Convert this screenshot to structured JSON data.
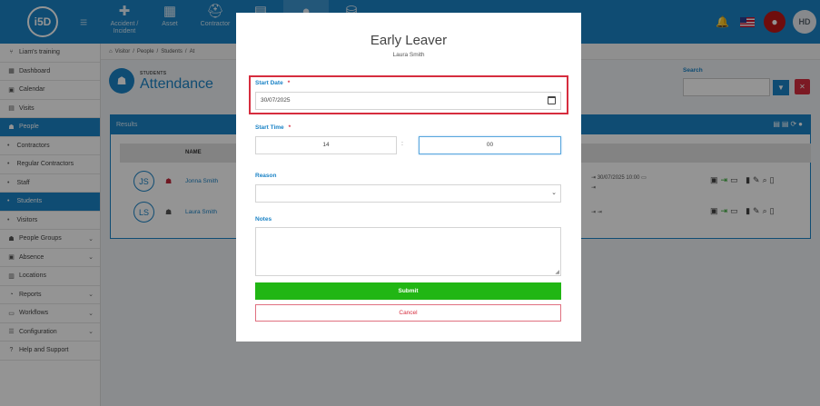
{
  "topbar": {
    "logo": "i5D",
    "nav": [
      {
        "label": "Accident / Incident",
        "icon": "medkit-icon"
      },
      {
        "label": "Asset",
        "icon": "boxes-icon"
      },
      {
        "label": "Contractor",
        "icon": "hardhat-icon"
      },
      {
        "label": "",
        "icon": "document-icon"
      },
      {
        "label": "",
        "icon": "person-icon"
      },
      {
        "label": "",
        "icon": "database-icon"
      }
    ],
    "user_initials": "HD"
  },
  "sidebar": {
    "items": [
      {
        "label": "Liam's training"
      },
      {
        "label": "Dashboard"
      },
      {
        "label": "Calendar"
      },
      {
        "label": "Visits"
      },
      {
        "label": "People"
      },
      {
        "label": "Contractors"
      },
      {
        "label": "Regular Contractors"
      },
      {
        "label": "Staff"
      },
      {
        "label": "Students"
      },
      {
        "label": "Visitors"
      },
      {
        "label": "People Groups"
      },
      {
        "label": "Absence"
      },
      {
        "label": "Locations"
      },
      {
        "label": "Reports"
      },
      {
        "label": "Workflows"
      },
      {
        "label": "Configuration"
      },
      {
        "label": "Help and Support"
      }
    ]
  },
  "breadcrumb": [
    "Visitor",
    "People",
    "Students",
    "At"
  ],
  "page": {
    "subtitle": "STUDENTS",
    "title": "Attendance"
  },
  "search": {
    "label": "Search",
    "placeholder": ""
  },
  "results": {
    "header": "Results",
    "column_name": "NAME",
    "rows": [
      {
        "initials": "JS",
        "name": "Jonna Smith",
        "time": "30/07/2025 10:00"
      },
      {
        "initials": "LS",
        "name": "Laura Smith",
        "time": ""
      }
    ]
  },
  "modal": {
    "title": "Early Leaver",
    "subtitle": "Laura Smith",
    "start_date_label": "Start Date",
    "start_date_value": "30/07/2025",
    "start_time_label": "Start Time",
    "hour": "14",
    "minute": "00",
    "colon": ":",
    "reason_label": "Reason",
    "reason_value": "",
    "notes_label": "Notes",
    "notes_value": "",
    "required_mark": "*",
    "submit": "Submit",
    "cancel": "Cancel"
  },
  "colors": {
    "primary": "#1b83c6",
    "submit": "#21b614",
    "danger": "#d62d3e"
  }
}
